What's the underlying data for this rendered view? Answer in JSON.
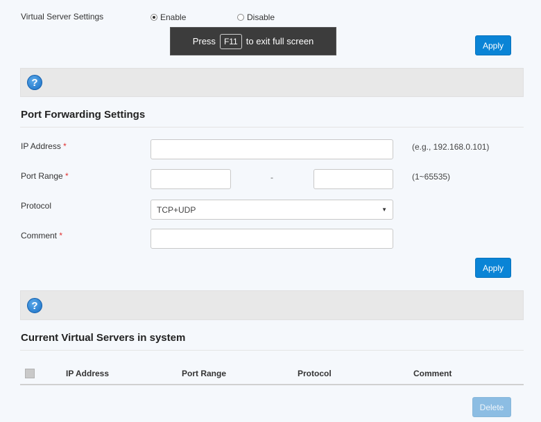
{
  "virtual_server": {
    "label": "Virtual Server Settings",
    "enable_label": "Enable",
    "disable_label": "Disable",
    "selected": "Enable"
  },
  "fullscreen_toast": {
    "before": "Press",
    "key": "F11",
    "after": "to exit full screen"
  },
  "apply_label": "Apply",
  "help_icon_glyph": "?",
  "port_forwarding": {
    "title": "Port Forwarding Settings",
    "ip_label": "IP Address",
    "ip_value": "",
    "ip_hint": "(e.g., 192.168.0.101)",
    "port_range_label": "Port Range",
    "port_start_value": "",
    "port_separator": "-",
    "port_end_value": "",
    "port_hint": "(1~65535)",
    "protocol_label": "Protocol",
    "protocol_value": "TCP+UDP",
    "comment_label": "Comment",
    "comment_value": "",
    "required_mark": "*"
  },
  "current_servers": {
    "title": "Current Virtual Servers in system",
    "columns": [
      "IP Address",
      "Port Range",
      "Protocol",
      "Comment"
    ],
    "rows": []
  },
  "delete_label": "Delete",
  "colors": {
    "accent": "#0a84d6",
    "required": "#e03030",
    "help_bar": "#e8e8e8"
  }
}
